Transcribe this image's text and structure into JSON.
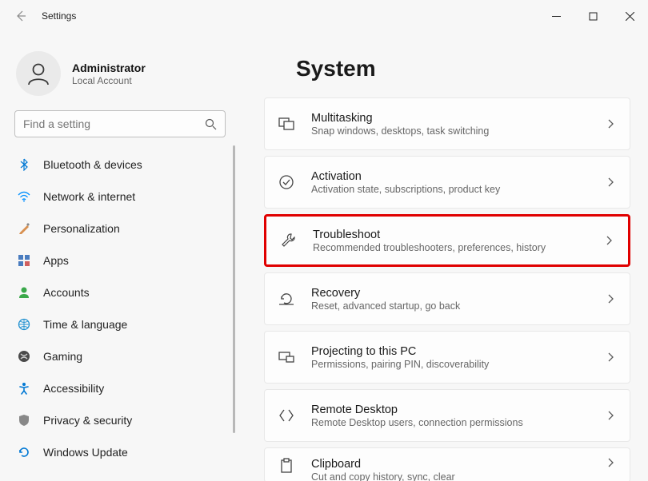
{
  "titlebar": {
    "title": "Settings"
  },
  "profile": {
    "name": "Administrator",
    "sub": "Local Account"
  },
  "search": {
    "placeholder": "Find a setting"
  },
  "nav": {
    "items": [
      {
        "label": "Bluetooth & devices"
      },
      {
        "label": "Network & internet"
      },
      {
        "label": "Personalization"
      },
      {
        "label": "Apps"
      },
      {
        "label": "Accounts"
      },
      {
        "label": "Time & language"
      },
      {
        "label": "Gaming"
      },
      {
        "label": "Accessibility"
      },
      {
        "label": "Privacy & security"
      },
      {
        "label": "Windows Update"
      }
    ]
  },
  "page": {
    "title": "System"
  },
  "cards": [
    {
      "title": "Multitasking",
      "sub": "Snap windows, desktops, task switching"
    },
    {
      "title": "Activation",
      "sub": "Activation state, subscriptions, product key"
    },
    {
      "title": "Troubleshoot",
      "sub": "Recommended troubleshooters, preferences, history"
    },
    {
      "title": "Recovery",
      "sub": "Reset, advanced startup, go back"
    },
    {
      "title": "Projecting to this PC",
      "sub": "Permissions, pairing PIN, discoverability"
    },
    {
      "title": "Remote Desktop",
      "sub": "Remote Desktop users, connection permissions"
    },
    {
      "title": "Clipboard",
      "sub": "Cut and copy history, sync, clear"
    }
  ]
}
